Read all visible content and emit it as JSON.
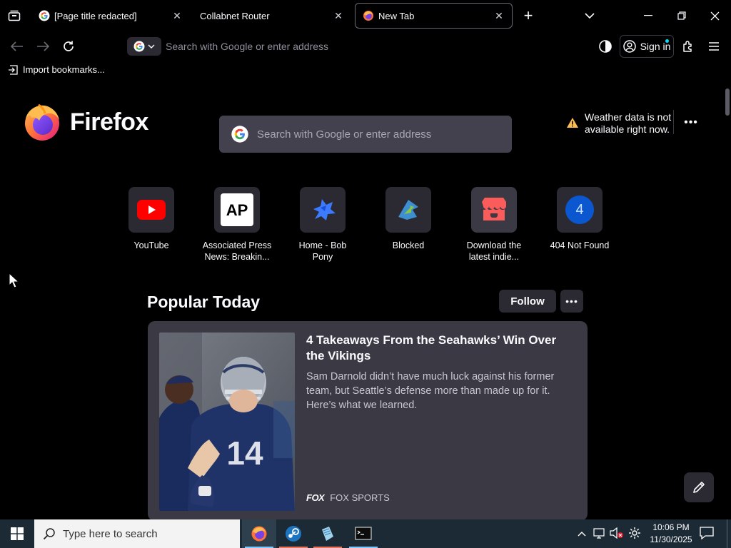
{
  "colors": {
    "background": "#000000",
    "tile": "#2b2a33",
    "search_field": "#42414d",
    "card": "#3a3944",
    "youtube_red": "#ff0000",
    "taskbar": "#1c2a36"
  },
  "tabs": [
    {
      "title": "[Page title redacted]",
      "favicon": "google-icon",
      "active": false
    },
    {
      "title": "Collabnet Router",
      "favicon": "none",
      "active": false
    },
    {
      "title": "New Tab",
      "favicon": "firefox-icon",
      "active": true
    }
  ],
  "urlbar": {
    "placeholder": "Search with Google or enter address"
  },
  "toolbar": {
    "signin_label": "Sign in"
  },
  "bookmarks": {
    "import_label": "Import bookmarks..."
  },
  "newtab": {
    "logo_text": "Firefox",
    "search_placeholder": "Search with Google or enter address",
    "weather": {
      "line1": "Weather data is not",
      "line2": "available right now."
    },
    "shortcuts": [
      {
        "label1": "YouTube",
        "label2": "",
        "icon": "youtube-icon"
      },
      {
        "label1": "Associated Press",
        "label2": "News: Breakin...",
        "icon": "ap-icon"
      },
      {
        "label1": "Home - Bob",
        "label2": "Pony",
        "icon": "bob-pony-icon"
      },
      {
        "label1": "Blocked",
        "label2": "",
        "icon": "blocked-site-icon"
      },
      {
        "label1": "Download the",
        "label2": "latest indie...",
        "icon": "itch-icon"
      },
      {
        "label1": "404 Not Found",
        "label2": "",
        "icon": "letter-icon",
        "letter": "4"
      }
    ],
    "popular": {
      "title": "Popular Today",
      "follow_label": "Follow",
      "story": {
        "title": "4 Takeaways From the Seahawks’ Win Over the Vikings",
        "description": "Sam Darnold didn’t have much luck against his former team, but Seattle’s defense more than made up for it. Here’s what we learned.",
        "source": "FOX SPORTS",
        "source_logo": "FOX"
      }
    }
  },
  "taskbar": {
    "search_placeholder": "Type here to search",
    "apps": [
      "firefox-icon",
      "steam-icon",
      "notepad-icon",
      "terminal-icon"
    ],
    "time": "10:06 PM",
    "date": "11/30/2025"
  }
}
